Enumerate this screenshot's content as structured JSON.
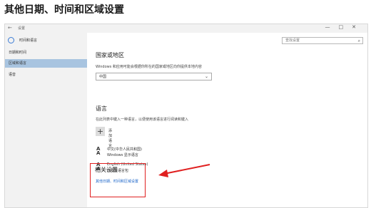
{
  "heading": "其他日期、时间和区域设置",
  "window": {
    "titlebar": {
      "back": "←",
      "title": "设置",
      "controls": "—□✕"
    },
    "sidebar": {
      "title": "时间和语言",
      "items": [
        {
          "label": "日期和时间"
        },
        {
          "label": "区域和语言"
        },
        {
          "label": "语音"
        }
      ]
    },
    "search": {
      "placeholder": "查找设置"
    },
    "region": {
      "heading": "国家或地区",
      "description": "Windows 和应用可能会根据你所在的国家或地区向你提供本地内容",
      "selected": "中国"
    },
    "language": {
      "heading": "语言",
      "description": "在此列表中键入一种语言，以便使用该语言进行阅读和键入",
      "add_label": "添加语言",
      "items": [
        {
          "line1": "中文(中华人民共和国)",
          "line2": "Windows 显示语言"
        },
        {
          "line1": "English (United States)",
          "line2": "已安装语言包"
        }
      ]
    },
    "related": {
      "heading": "相关设置",
      "link": "其他日期、时间和区域设置"
    }
  },
  "colors": {
    "accent": "#3a7bd5",
    "highlight": "#e02020",
    "sidebar_active": "#a8c4e0"
  }
}
